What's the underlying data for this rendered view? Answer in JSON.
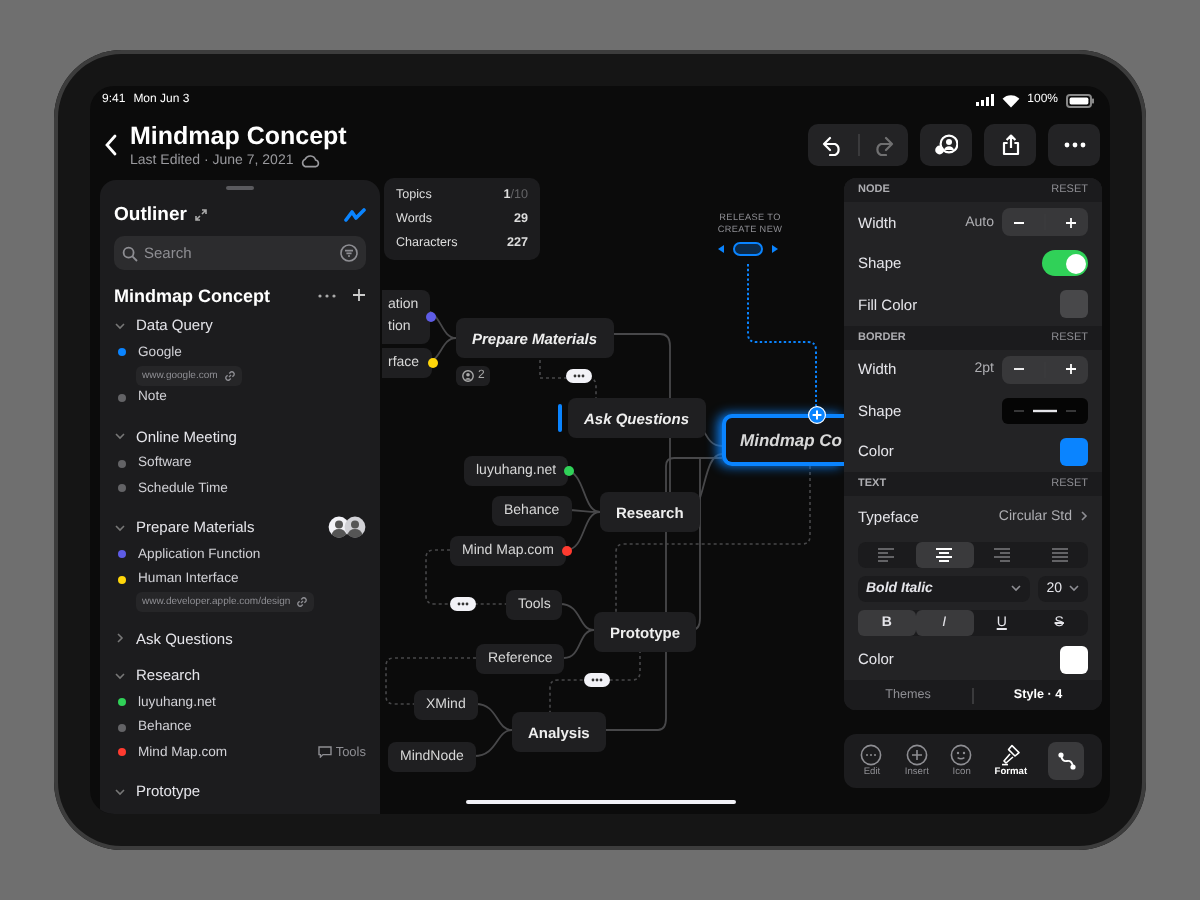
{
  "status_bar": {
    "time": "9:41",
    "date": "Mon Jun 3",
    "battery": "100%"
  },
  "header": {
    "title": "Mindmap Concept",
    "subtitle": "Last Edited · June 7, 2021"
  },
  "toolbar": {
    "undo": {
      "disabled": false
    },
    "redo": {
      "disabled": true
    }
  },
  "outliner": {
    "title": "Outliner",
    "search": {
      "placeholder": "Search"
    },
    "document": "Mindmap Concept",
    "sections": [
      {
        "title": "Data Query",
        "expanded": true,
        "children": [
          {
            "label": "Google",
            "color": "#0a84ff",
            "link": "www.google.com"
          },
          {
            "label": "Note",
            "color": "#636366"
          }
        ]
      },
      {
        "title": "Online Meeting",
        "expanded": true,
        "children": [
          {
            "label": "Software",
            "color": "#636366"
          },
          {
            "label": "Schedule Time",
            "color": "#636366"
          }
        ]
      },
      {
        "title": "Prepare Materials",
        "expanded": true,
        "shared": true,
        "children": [
          {
            "label": "Application Function",
            "color": "#5e5ce6"
          },
          {
            "label": "Human Interface",
            "color": "#ffd60a",
            "link": "www.developer.apple.com/design"
          }
        ]
      },
      {
        "title": "Ask Questions",
        "expanded": false
      },
      {
        "title": "Research",
        "expanded": true,
        "children": [
          {
            "label": "luyuhang.net",
            "color": "#30d158"
          },
          {
            "label": "Behance",
            "color": "#636366"
          },
          {
            "label": "Mind Map.com",
            "color": "#ff3b30",
            "note": "Tools"
          }
        ]
      },
      {
        "title": "Prototype",
        "expanded": true
      }
    ]
  },
  "stats": [
    {
      "label": "Topics",
      "value": "1",
      "total": "/10"
    },
    {
      "label": "Words",
      "value": "29"
    },
    {
      "label": "Characters",
      "value": "227"
    }
  ],
  "canvas": {
    "hint": "RELEASE TO CREATE NEW",
    "nodes": [
      {
        "text": "ation\ntion",
        "kind": "leaf",
        "italic": false,
        "color": "#5e5ce6"
      },
      {
        "text": "rface",
        "kind": "leaf",
        "italic": false,
        "color": "#ffd60a"
      },
      {
        "text": "Prepare Materials",
        "kind": "branch",
        "italic": true,
        "badge": "2"
      },
      {
        "text": "Ask Questions",
        "kind": "branch",
        "italic": true,
        "drop_target": true
      },
      {
        "text": "Mindmap Co",
        "kind": "central",
        "italic": true,
        "selected": true
      },
      {
        "text": "luyuhang.net",
        "kind": "leaf",
        "italic": false,
        "color": "#30d158"
      },
      {
        "text": "Behance",
        "kind": "leaf",
        "italic": false
      },
      {
        "text": "Research",
        "kind": "branch",
        "italic": false
      },
      {
        "text": "Mind Map.com",
        "kind": "leaf",
        "italic": false,
        "color": "#ff3b30"
      },
      {
        "text": "Tools",
        "kind": "leaf",
        "italic": false
      },
      {
        "text": "Prototype",
        "kind": "branch",
        "italic": false
      },
      {
        "text": "Reference",
        "kind": "leaf",
        "italic": false
      },
      {
        "text": "XMind",
        "kind": "leaf",
        "italic": false
      },
      {
        "text": "Analysis",
        "kind": "branch",
        "italic": false
      },
      {
        "text": "MindNode",
        "kind": "leaf",
        "italic": false
      }
    ]
  },
  "inspector": {
    "sections": [
      {
        "title": "NODE",
        "reset": "RESET",
        "rows": [
          {
            "kind": "stepper",
            "label": "Width",
            "value": "Auto"
          },
          {
            "kind": "toggle",
            "label": "Shape",
            "on": true
          },
          {
            "kind": "swatch",
            "label": "Fill Color",
            "color": "#48484a"
          }
        ]
      },
      {
        "title": "BORDER",
        "reset": "RESET",
        "rows": [
          {
            "kind": "stepper",
            "label": "Width",
            "value": "2pt"
          },
          {
            "kind": "line-style",
            "label": "Shape"
          },
          {
            "kind": "swatch",
            "label": "Color",
            "color": "#0a84ff"
          }
        ]
      },
      {
        "title": "TEXT",
        "reset": "RESET",
        "rows": [
          {
            "kind": "link",
            "label": "Typeface",
            "value": "Circular Std"
          },
          {
            "kind": "align",
            "options": [
              {
                "kind": "left",
                "selected": false
              },
              {
                "kind": "center",
                "selected": true
              },
              {
                "kind": "right",
                "selected": false
              },
              {
                "kind": "justify",
                "selected": false
              }
            ]
          },
          {
            "kind": "font",
            "style": "Bold Italic",
            "size": "20"
          },
          {
            "kind": "format",
            "options": [
              {
                "kind": "bold",
                "label": "B",
                "selected": true
              },
              {
                "kind": "italic",
                "label": "I",
                "selected": true
              },
              {
                "kind": "underline",
                "label": "U",
                "selected": false
              },
              {
                "kind": "strike",
                "label": "S",
                "selected": false
              }
            ]
          },
          {
            "kind": "swatch",
            "label": "Color",
            "color": "#ffffff"
          }
        ]
      }
    ],
    "tabs": [
      {
        "label": "Themes",
        "selected": false
      },
      {
        "label": "Style · 4",
        "selected": true
      }
    ]
  },
  "bottom_toolbar": [
    {
      "kind": "edit",
      "label": "Edit",
      "selected": false
    },
    {
      "kind": "insert",
      "label": "Insert",
      "selected": false
    },
    {
      "kind": "icon",
      "label": "Icon",
      "selected": false
    },
    {
      "kind": "format",
      "label": "Format",
      "selected": true
    },
    {
      "kind": "connect",
      "selected": true
    }
  ]
}
